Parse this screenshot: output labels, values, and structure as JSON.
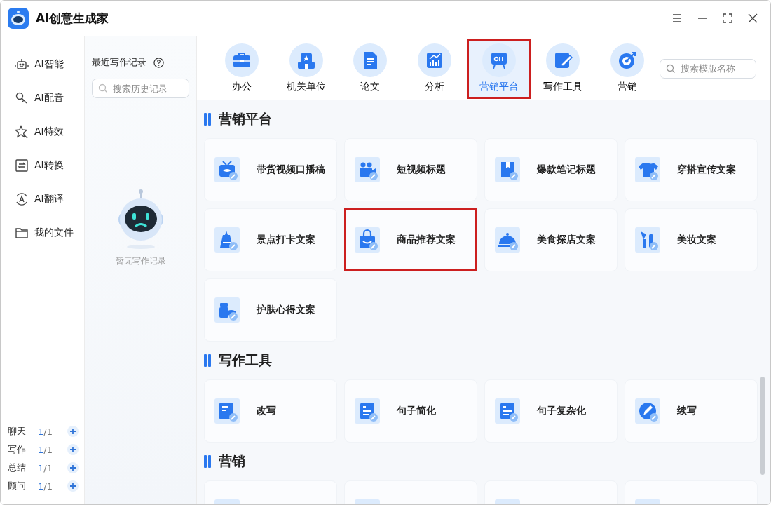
{
  "window": {
    "title": "AI创意生成家"
  },
  "nav": [
    {
      "label": "AI智能",
      "selected": false
    },
    {
      "label": "AI配音",
      "selected": false
    },
    {
      "label": "AI特效",
      "selected": false
    },
    {
      "label": "AI转换",
      "selected": false
    },
    {
      "label": "AI翻译",
      "selected": false
    },
    {
      "label": "我的文件",
      "selected": false
    }
  ],
  "quotas": [
    {
      "label": "聊天",
      "used": "1",
      "rest": "/1"
    },
    {
      "label": "写作",
      "used": "1",
      "rest": "/1"
    },
    {
      "label": "总结",
      "used": "1",
      "rest": "/1"
    },
    {
      "label": "顾问",
      "used": "1",
      "rest": "/1"
    }
  ],
  "history": {
    "title": "最近写作记录",
    "search": {
      "placeholder": "搜索历史记录"
    },
    "empty_text": "暂无写作记录"
  },
  "categories": [
    {
      "label": "办公",
      "selected": false,
      "highlighted": false
    },
    {
      "label": "机关单位",
      "selected": false,
      "highlighted": false
    },
    {
      "label": "论文",
      "selected": false,
      "highlighted": false
    },
    {
      "label": "分析",
      "selected": false,
      "highlighted": false
    },
    {
      "label": "营销平台",
      "selected": true,
      "highlighted": true
    },
    {
      "label": "写作工具",
      "selected": false,
      "highlighted": false
    },
    {
      "label": "营销",
      "selected": false,
      "highlighted": false
    }
  ],
  "template_search": {
    "placeholder": "搜索模版名称"
  },
  "sections": [
    {
      "title": "营销平台",
      "cards": [
        {
          "kind": "full",
          "label": "带货视频口播稿",
          "highlighted": false
        },
        {
          "kind": "full",
          "label": "短视频标题",
          "highlighted": false
        },
        {
          "kind": "full",
          "label": "爆款笔记标题",
          "highlighted": false
        },
        {
          "kind": "full",
          "label": "穿搭宣传文案",
          "highlighted": false
        },
        {
          "kind": "full",
          "label": "景点打卡文案",
          "highlighted": false
        },
        {
          "kind": "full",
          "label": "商品推荐文案",
          "highlighted": true
        },
        {
          "kind": "full",
          "label": "美食探店文案",
          "highlighted": false
        },
        {
          "kind": "full",
          "label": "美妆文案",
          "highlighted": false
        },
        {
          "kind": "full",
          "label": "护肤心得文案",
          "highlighted": false
        }
      ]
    },
    {
      "title": "写作工具",
      "cards": [
        {
          "kind": "full",
          "label": "改写",
          "highlighted": false
        },
        {
          "kind": "full",
          "label": "句子简化",
          "highlighted": false
        },
        {
          "kind": "full",
          "label": "句子复杂化",
          "highlighted": false
        },
        {
          "kind": "full",
          "label": "续写",
          "highlighted": false
        }
      ]
    },
    {
      "title": "营销",
      "cards": [
        {
          "kind": "partial",
          "highlighted": false
        },
        {
          "kind": "partial",
          "highlighted": false
        },
        {
          "kind": "partial",
          "highlighted": false
        },
        {
          "kind": "partial",
          "highlighted": false
        }
      ]
    }
  ]
}
